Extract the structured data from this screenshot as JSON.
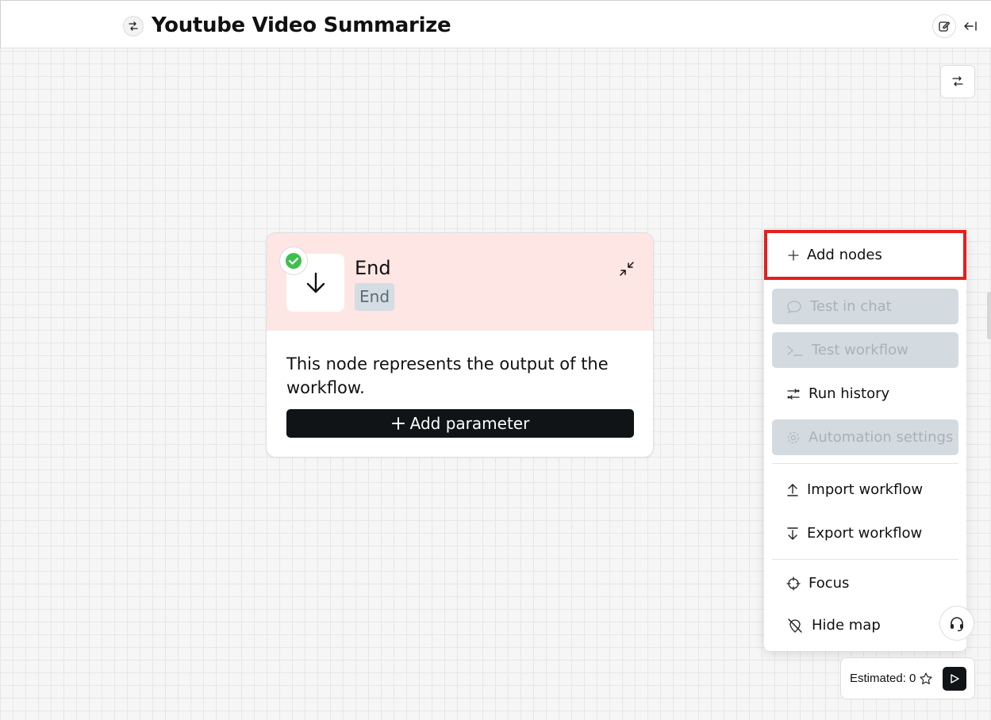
{
  "header": {
    "title": "Youtube Video Summarize",
    "title_icon": "workflow-icon",
    "edit_icon": "edit-icon",
    "collapse_icon": "collapse-panel-icon"
  },
  "canvas": {
    "settings_icon": "workflow-settings-icon"
  },
  "node": {
    "name": "End",
    "tag": "End",
    "status": "success",
    "description": "This node represents the output of the workflow.",
    "add_parameter_label": "Add parameter",
    "header_color": "#fde6e4"
  },
  "menu": {
    "items": [
      {
        "label": "Add nodes",
        "icon": "plus-icon",
        "enabled": true,
        "highlighted": true
      },
      {
        "label": "Test in chat",
        "icon": "chat-icon",
        "enabled": false
      },
      {
        "label": "Test workflow",
        "icon": "terminal-icon",
        "enabled": false
      },
      {
        "label": "Run history",
        "icon": "history-icon",
        "enabled": true
      },
      {
        "label": "Automation settings",
        "icon": "gear-icon",
        "enabled": false
      },
      {
        "label": "Import workflow",
        "icon": "upload-icon",
        "enabled": true
      },
      {
        "label": "Export workflow",
        "icon": "download-icon",
        "enabled": true
      },
      {
        "label": "Focus",
        "icon": "crosshair-icon",
        "enabled": true
      },
      {
        "label": "Hide map",
        "icon": "hide-map-icon",
        "enabled": true
      }
    ]
  },
  "footer": {
    "estimated_label": "Estimated: 0",
    "star_icon": "star-icon",
    "run_icon": "play-icon"
  },
  "colors": {
    "highlight_border": "#e41f1f",
    "primary_button": "#111416",
    "disabled_bg": "#d4dbe0",
    "success": "#3fbf4f"
  }
}
